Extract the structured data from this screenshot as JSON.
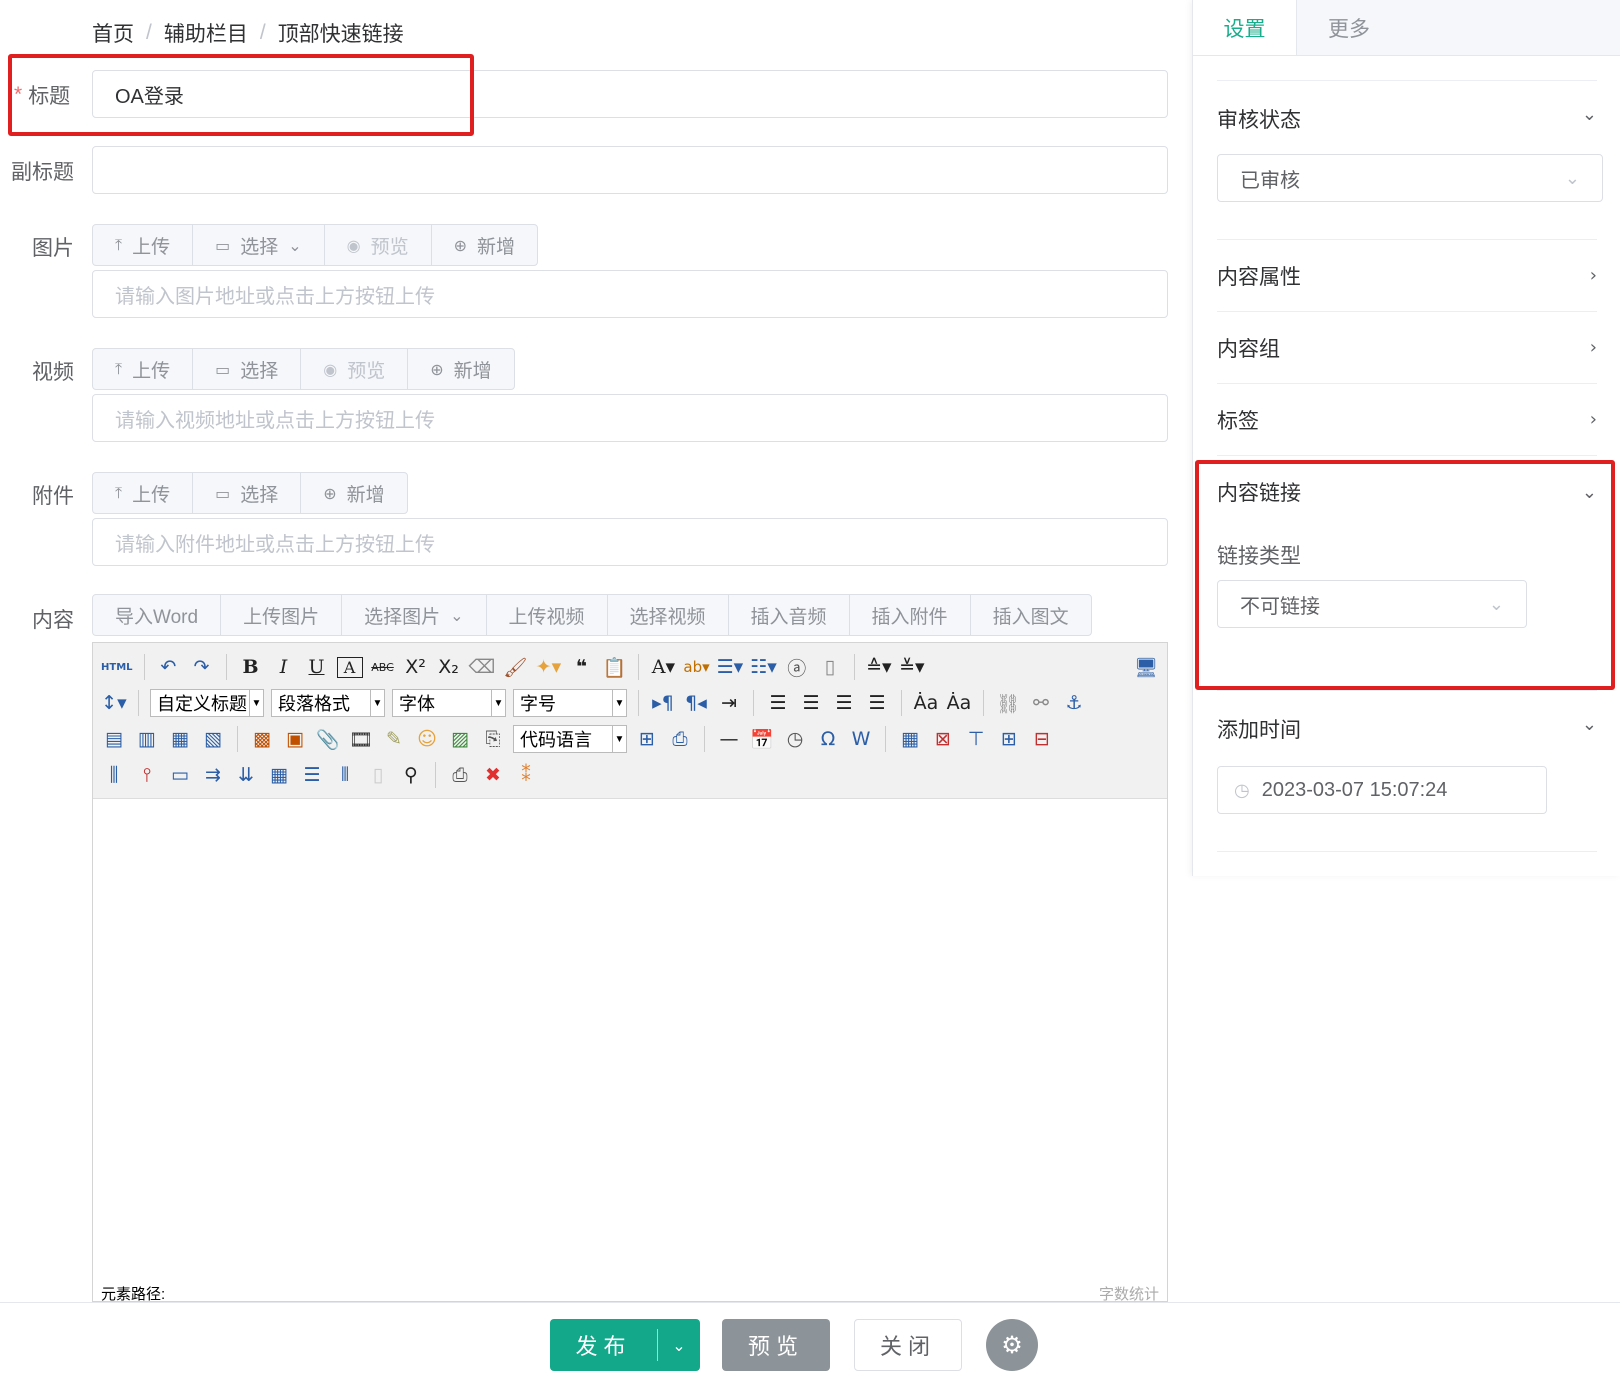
{
  "breadcrumb": {
    "items": [
      "首页",
      "辅助栏目",
      "顶部快速链接"
    ],
    "separator": "/"
  },
  "form": {
    "title_label": "标题",
    "title_required": "*",
    "title_value": "OA登录",
    "subtitle_label": "副标题",
    "subtitle_value": "",
    "image": {
      "label": "图片",
      "buttons": [
        "上传",
        "选择",
        "预览",
        "新增"
      ],
      "placeholder": "请输入图片地址或点击上方按钮上传"
    },
    "video": {
      "label": "视频",
      "buttons": [
        "上传",
        "选择",
        "预览",
        "新增"
      ],
      "placeholder": "请输入视频地址或点击上方按钮上传"
    },
    "attachment": {
      "label": "附件",
      "buttons": [
        "上传",
        "选择",
        "新增"
      ],
      "placeholder": "请输入附件地址或点击上方按钮上传"
    },
    "content": {
      "label": "内容",
      "toolbar": [
        "导入Word",
        "上传图片",
        "选择图片",
        "上传视频",
        "选择视频",
        "插入音频",
        "插入附件",
        "插入图文"
      ]
    }
  },
  "editor": {
    "html_label": "HTML",
    "custom_heading": "自定义标题",
    "paragraph_format": "段落格式",
    "font_family": "字体",
    "font_size": "字号",
    "code_language": "代码语言",
    "status_left": "元素路径:",
    "status_right": "字数统计"
  },
  "sidebar": {
    "tabs": [
      "设置",
      "更多"
    ],
    "review": {
      "title": "审核状态",
      "value": "已审核"
    },
    "content_attr": "内容属性",
    "content_group": "内容组",
    "tags": "标签",
    "content_link": {
      "title": "内容链接",
      "link_type_label": "链接类型",
      "link_type_value": "不可链接"
    },
    "add_time": {
      "title": "添加时间",
      "value": "2023-03-07 15:07:24"
    }
  },
  "footer": {
    "publish": "发布",
    "preview": "预览",
    "close": "关闭"
  },
  "colors": {
    "accent": "#1aad8c",
    "highlight": "#e02020",
    "gray_button": "#8c9399"
  }
}
